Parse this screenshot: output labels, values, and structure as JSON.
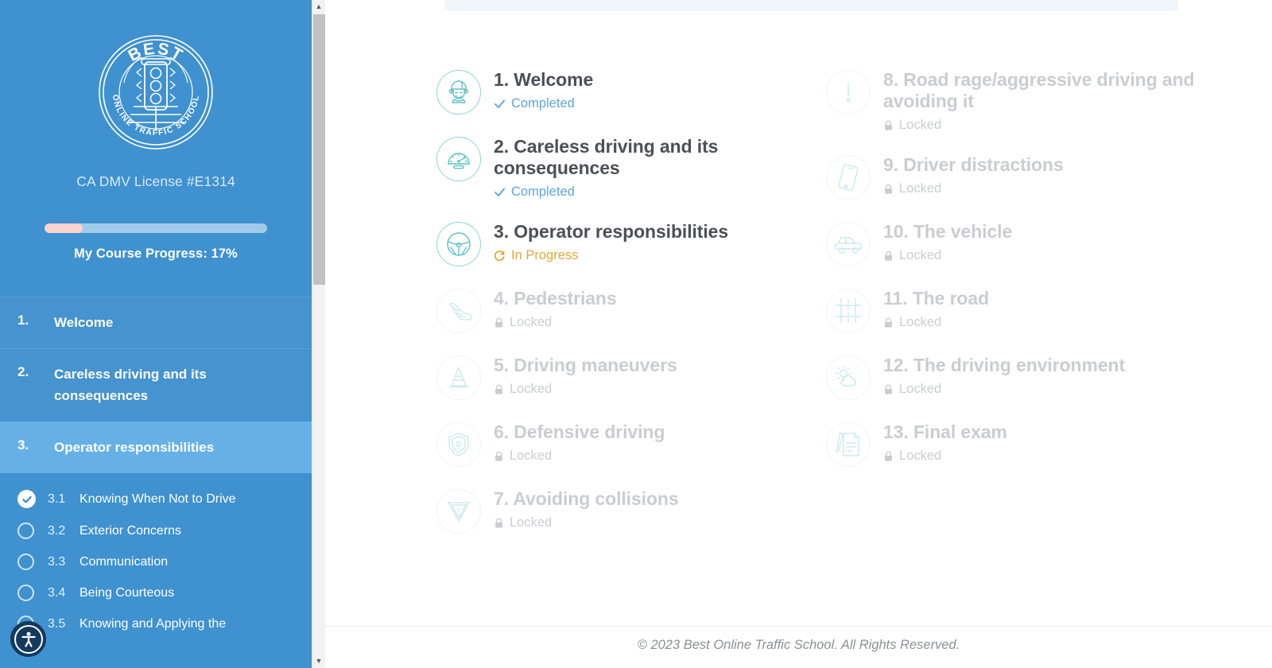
{
  "sidebar": {
    "logo": {
      "icon": "traffic-light-badge-logo",
      "top_text": "BEST",
      "bottom_text": "ONLINE TRAFFIC SCHOOL"
    },
    "license_text": "CA DMV License #E1314",
    "progress": {
      "label": "My Course Progress:",
      "percent_text": "17%",
      "percent_value": 17,
      "fill_color": "#fbd3cf",
      "track_color": "#9fcbe8"
    },
    "chapters": [
      {
        "num": "1.",
        "title": "Welcome",
        "active": false
      },
      {
        "num": "2.",
        "title": "Careless driving and its consequences",
        "active": false
      },
      {
        "num": "3.",
        "title": "Operator responsibilities",
        "active": true
      }
    ],
    "sublessons": [
      {
        "num": "3.1",
        "label": "Knowing When Not to Drive",
        "state": "completed"
      },
      {
        "num": "3.2",
        "label": "Exterior Concerns",
        "state": "pending"
      },
      {
        "num": "3.3",
        "label": "Communication",
        "state": "pending"
      },
      {
        "num": "3.4",
        "label": "Being Courteous",
        "state": "pending"
      },
      {
        "num": "3.5",
        "label": "Knowing and Applying the",
        "state": "pending"
      }
    ],
    "accessibility_button": {
      "icon": "accessibility-person-icon",
      "label": "Accessibility"
    }
  },
  "scrollbar": {
    "up_arrow": "▲",
    "down_arrow": "▼"
  },
  "main": {
    "status_labels": {
      "completed": "Completed",
      "in_progress": "In Progress",
      "locked": "Locked"
    },
    "status_colors": {
      "completed": "#5ba5dd",
      "in_progress": "#e0a93a",
      "locked": "#c9cdd1"
    },
    "modules_left": [
      {
        "title": "1. Welcome",
        "status": "Completed",
        "state": "completed",
        "icon": "student-face-icon"
      },
      {
        "title": "2. Careless driving and its consequences",
        "status": "Completed",
        "state": "completed",
        "icon": "speedometer-icon"
      },
      {
        "title": "3. Operator responsibilities",
        "status": "In Progress",
        "state": "inprogress",
        "icon": "steering-wheel-icon"
      },
      {
        "title": "4. Pedestrians",
        "status": "Locked",
        "state": "locked",
        "icon": "shoe-footstep-icon"
      },
      {
        "title": "5. Driving maneuvers",
        "status": "Locked",
        "state": "locked",
        "icon": "traffic-cone-icon"
      },
      {
        "title": "6. Defensive driving",
        "status": "Locked",
        "state": "locked",
        "icon": "shield-icon"
      },
      {
        "title": "7. Avoiding collisions",
        "status": "Locked",
        "state": "locked",
        "icon": "yield-warning-icon"
      }
    ],
    "modules_right": [
      {
        "title": "8. Road rage/aggressive driving and avoiding it",
        "status": "Locked",
        "state": "locked",
        "icon": "exclamation-circle-icon"
      },
      {
        "title": "9. Driver distractions",
        "status": "Locked",
        "state": "locked",
        "icon": "smartphone-icon"
      },
      {
        "title": "10. The vehicle",
        "status": "Locked",
        "state": "locked",
        "icon": "car-icon"
      },
      {
        "title": "11. The road",
        "status": "Locked",
        "state": "locked",
        "icon": "road-lanes-icon"
      },
      {
        "title": "12. The driving environment",
        "status": "Locked",
        "state": "locked",
        "icon": "sun-cloud-weather-icon"
      },
      {
        "title": "13. Final exam",
        "status": "Locked",
        "state": "locked",
        "icon": "exam-paper-pencil-icon"
      }
    ]
  },
  "footer": {
    "copyright": "© 2023 Best Online Traffic School. All Rights Reserved."
  }
}
